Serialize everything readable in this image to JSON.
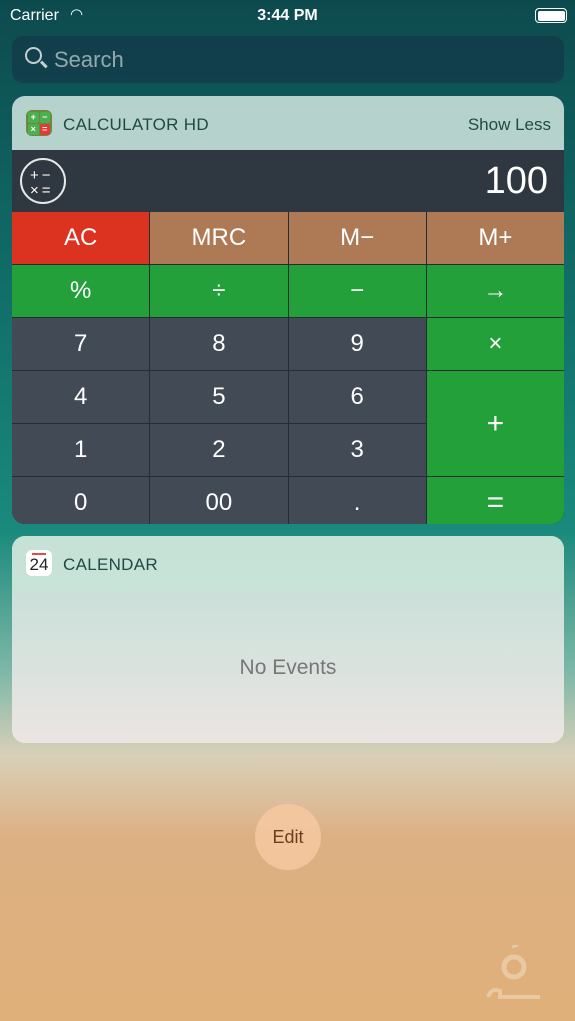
{
  "status": {
    "carrier": "Carrier",
    "time": "3:44 PM",
    "wifi_icon": "wifi-icon",
    "battery_level": 1.0
  },
  "search": {
    "placeholder": "Search"
  },
  "calculator": {
    "title": "CALCULATOR HD",
    "toggle": "Show Less",
    "display": "100",
    "ops_icon": "+ −\n× =",
    "keys": {
      "ac": "AC",
      "mrc": "MRC",
      "mminus": "M−",
      "mplus": "M+",
      "percent": "%",
      "divide": "÷",
      "minus": "−",
      "arrow": "→",
      "k7": "7",
      "k8": "8",
      "k9": "9",
      "multiply": "×",
      "k4": "4",
      "k5": "5",
      "k6": "6",
      "plus": "+",
      "k1": "1",
      "k2": "2",
      "k3": "3",
      "k0": "0",
      "k00": "00",
      "dot": ".",
      "equals": "="
    },
    "colors": {
      "red": "#dc3220",
      "brown": "#ad7a55",
      "green": "#23a03a",
      "dark": "#424b55"
    }
  },
  "calendar": {
    "title": "CALENDAR",
    "icon_day": "24",
    "empty": "No Events"
  },
  "edit": "Edit"
}
